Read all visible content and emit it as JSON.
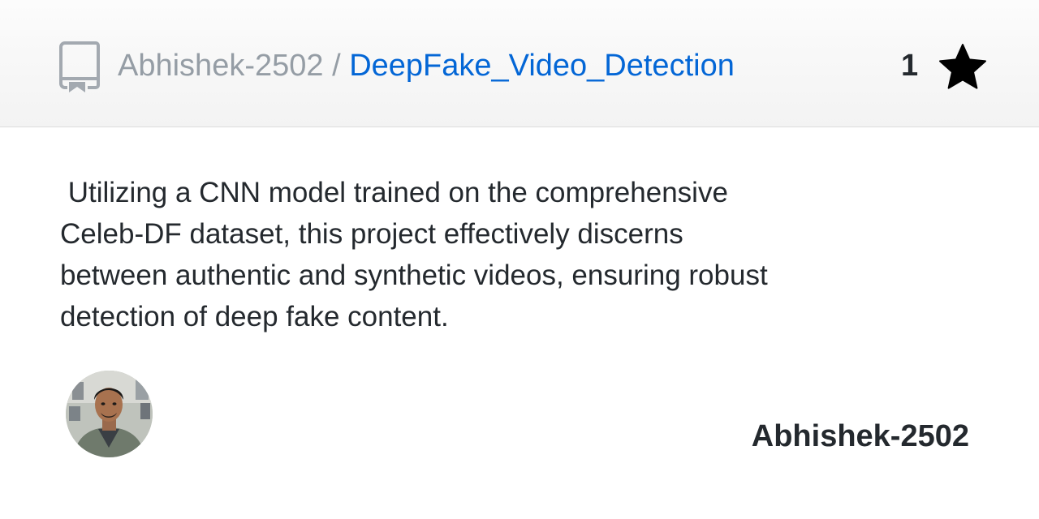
{
  "header": {
    "owner": "Abhishek-2502",
    "separator": " / ",
    "repo_name": "DeepFake_Video_Detection",
    "star_count": "1",
    "repo_icon": "repo-book-icon",
    "star_icon": "star-icon"
  },
  "description": " Utilizing a CNN model trained on the comprehensive\nCeleb-DF dataset, this project effectively discerns\nbetween authentic and synthetic videos, ensuring robust\ndetection of deep fake content.",
  "footer": {
    "avatar_icon": "user-avatar",
    "username": "Abhishek-2502"
  },
  "colors": {
    "link": "#0366d6",
    "muted": "#959da5",
    "text": "#24292e",
    "header_bg": "#f5f5f5"
  }
}
